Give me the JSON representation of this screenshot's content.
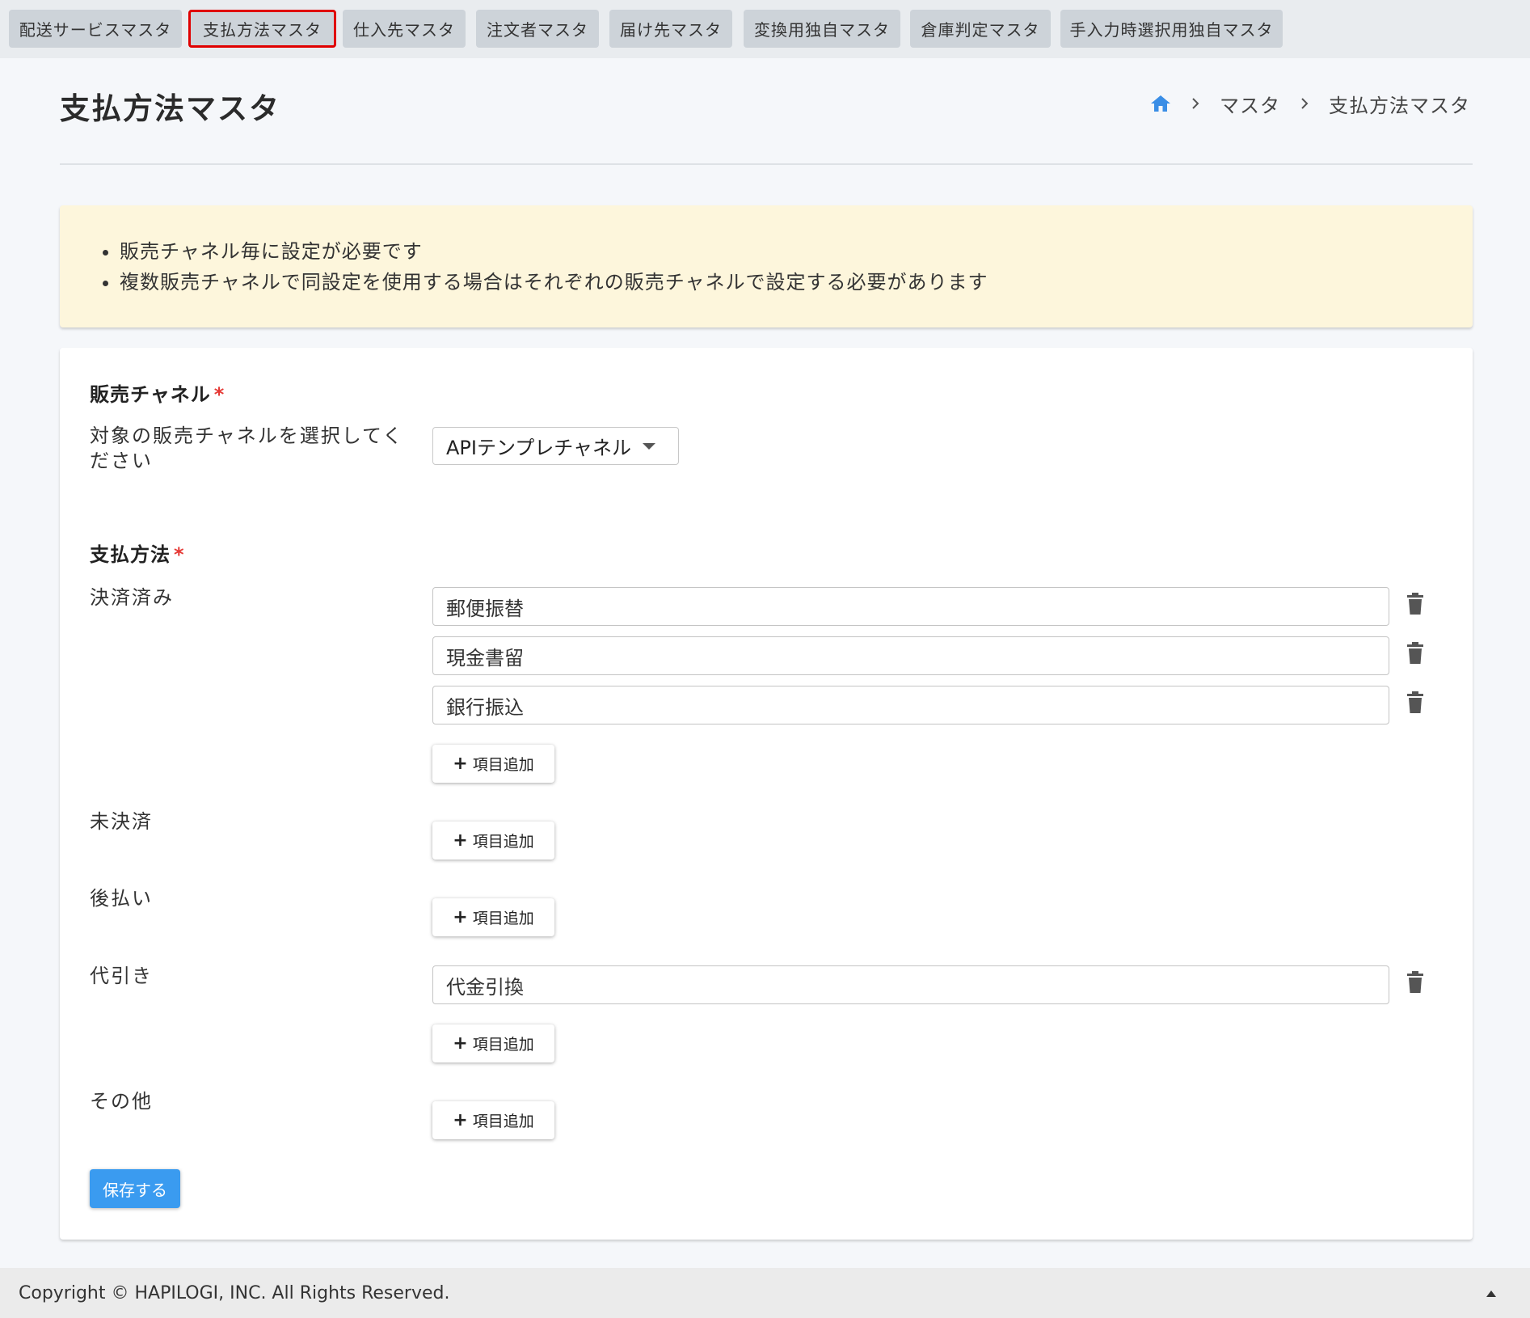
{
  "tabs": [
    {
      "label": "配送サービスマスタ",
      "active": false
    },
    {
      "label": "支払方法マスタ",
      "active": true
    },
    {
      "label": "仕入先マスタ",
      "active": false
    },
    {
      "label": "注文者マスタ",
      "active": false
    },
    {
      "label": "届け先マスタ",
      "active": false
    },
    {
      "label": "変換用独自マスタ",
      "active": false
    },
    {
      "label": "倉庫判定マスタ",
      "active": false
    },
    {
      "label": "手入力時選択用独自マスタ",
      "active": false
    }
  ],
  "page": {
    "title": "支払方法マスタ"
  },
  "breadcrumb": {
    "home_icon": "home-icon",
    "items": [
      "マスタ",
      "支払方法マスタ"
    ]
  },
  "notice": {
    "items": [
      "販売チャネル毎に設定が必要です",
      "複数販売チャネルで同設定を使用する場合はそれぞれの販売チャネルで設定する必要があります"
    ]
  },
  "sales_channel": {
    "title": "販売チャネル",
    "required_mark": "*",
    "label": "対象の販売チャネルを選択してください",
    "selected": "APIテンプレチャネル"
  },
  "payment": {
    "title": "支払方法",
    "required_mark": "*",
    "add_label": "項目追加",
    "add_icon": "+",
    "groups": [
      {
        "label": "決済済み",
        "items": [
          "郵便振替",
          "現金書留",
          "銀行振込"
        ]
      },
      {
        "label": "未決済",
        "items": []
      },
      {
        "label": "後払い",
        "items": []
      },
      {
        "label": "代引き",
        "items": [
          "代金引換"
        ]
      },
      {
        "label": "その他",
        "items": []
      }
    ]
  },
  "save_label": "保存する",
  "footer": {
    "copyright": "Copyright © HAPILOGI, INC. All Rights Reserved."
  },
  "colors": {
    "accent": "#3a9bf0",
    "highlight": "#e00000",
    "required": "#e53935",
    "notice_bg": "#fdf6dc"
  }
}
